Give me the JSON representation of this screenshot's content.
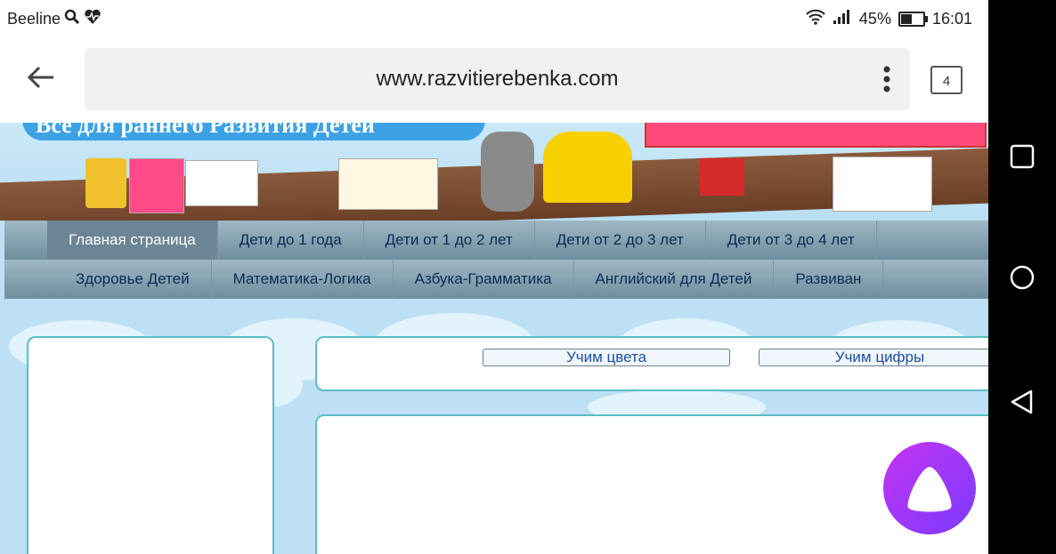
{
  "status_bar": {
    "carrier": "Beeline",
    "battery_percent": "45%",
    "battery_level": 0.45,
    "time": "16:01",
    "icons": [
      "search-icon",
      "heart-rate-icon",
      "wifi-icon",
      "signal-icon",
      "battery-icon"
    ]
  },
  "browser": {
    "url": "www.razvitierebenka.com",
    "tab_count": "4"
  },
  "banner": {
    "text": "Все для раннего Развития Детей"
  },
  "nav_row1": [
    {
      "label": "Главная страница",
      "active": true
    },
    {
      "label": "Дети до 1 года"
    },
    {
      "label": "Дети от 1 до 2 лет"
    },
    {
      "label": "Дети от 2 до 3 лет"
    },
    {
      "label": "Дети от 3 до 4 лет"
    }
  ],
  "nav_row2": [
    {
      "label": "Здоровье Детей"
    },
    {
      "label": "Математика-Логика"
    },
    {
      "label": "Азбука-Грамматика"
    },
    {
      "label": "Английский для Детей"
    },
    {
      "label": "Развиван"
    }
  ],
  "content": {
    "btn_colors": "Учим цвета",
    "btn_digits": "Учим цифры"
  },
  "colors": {
    "nav_bg": "#8aa6b5",
    "box_border": "#5bbdc4",
    "link": "#1f4fa3",
    "fab": "#a23bf5"
  }
}
